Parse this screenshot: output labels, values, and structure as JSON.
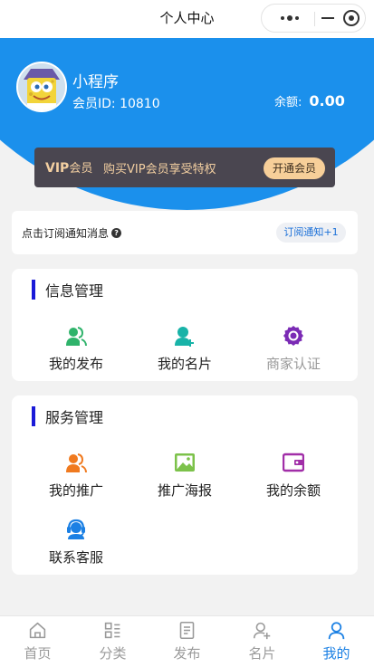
{
  "navbar": {
    "title": "个人中心",
    "icons": [
      "more-icon",
      "minimize-icon",
      "close-target-icon"
    ]
  },
  "profile": {
    "name": "小程序",
    "member_id": "会员ID: 10810",
    "balance_label": "余额:",
    "balance_value": "0.00"
  },
  "vip": {
    "label_prefix": "VIP",
    "label_suffix": "会员",
    "description": "购买VIP会员享受特权",
    "button": "开通会员"
  },
  "subscribe": {
    "text": "点击订阅通知消息",
    "button": "订阅通知+1"
  },
  "info_section": {
    "title": "信息管理",
    "items": [
      {
        "label": "我的发布",
        "icon": "user-publish-icon",
        "color": "#2fb36b"
      },
      {
        "label": "我的名片",
        "icon": "user-add-icon",
        "color": "#18b3a8"
      },
      {
        "label": "商家认证",
        "icon": "award-ribbon-icon",
        "color": "#7b2bb5"
      }
    ]
  },
  "service_section": {
    "title": "服务管理",
    "items": [
      {
        "label": "我的推广",
        "icon": "user-promote-icon",
        "color": "#f07a1f"
      },
      {
        "label": "推广海报",
        "icon": "image-poster-icon",
        "color": "#7cc24a"
      },
      {
        "label": "我的余额",
        "icon": "wallet-icon",
        "color": "#a12ea8"
      },
      {
        "label": "联系客服",
        "icon": "headset-icon",
        "color": "#1b80e4"
      }
    ]
  },
  "tabbar": {
    "active_color": "#1b80e4",
    "inactive_color": "#9a9a9a",
    "items": [
      {
        "label": "首页",
        "icon": "home-icon"
      },
      {
        "label": "分类",
        "icon": "category-icon"
      },
      {
        "label": "发布",
        "icon": "document-icon"
      },
      {
        "label": "名片",
        "icon": "person-add-icon"
      },
      {
        "label": "我的",
        "icon": "person-icon",
        "active": true
      }
    ]
  },
  "colors": {
    "header_blue": "#1b90ec",
    "vip_card": "#4a4650",
    "vip_gold": "#f7cf99",
    "section_bar": "#1a1ad8"
  }
}
